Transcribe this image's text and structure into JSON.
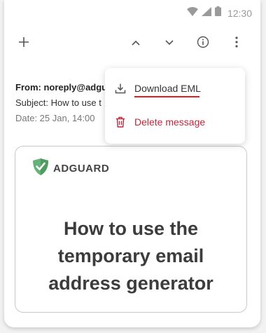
{
  "status": {
    "time": "12:30"
  },
  "toolbar": {
    "icons": [
      "plus-icon",
      "chevron-up-icon",
      "chevron-down-icon",
      "info-icon",
      "more-vert-icon"
    ]
  },
  "email": {
    "from": "From: noreply@adgu",
    "subject": "Subject: How to use t",
    "date": "Date: 25 Jan, 14:00"
  },
  "menu": {
    "download_label": "Download EML",
    "delete_label": "Delete message"
  },
  "card": {
    "brand": "ADGUARD",
    "headline_1": "How to use the",
    "headline_2": "temporary email",
    "headline_3": "address generator"
  },
  "colors": {
    "accent_underline": "#e02020",
    "delete": "#c2263a",
    "brand_green": "#67b279"
  }
}
